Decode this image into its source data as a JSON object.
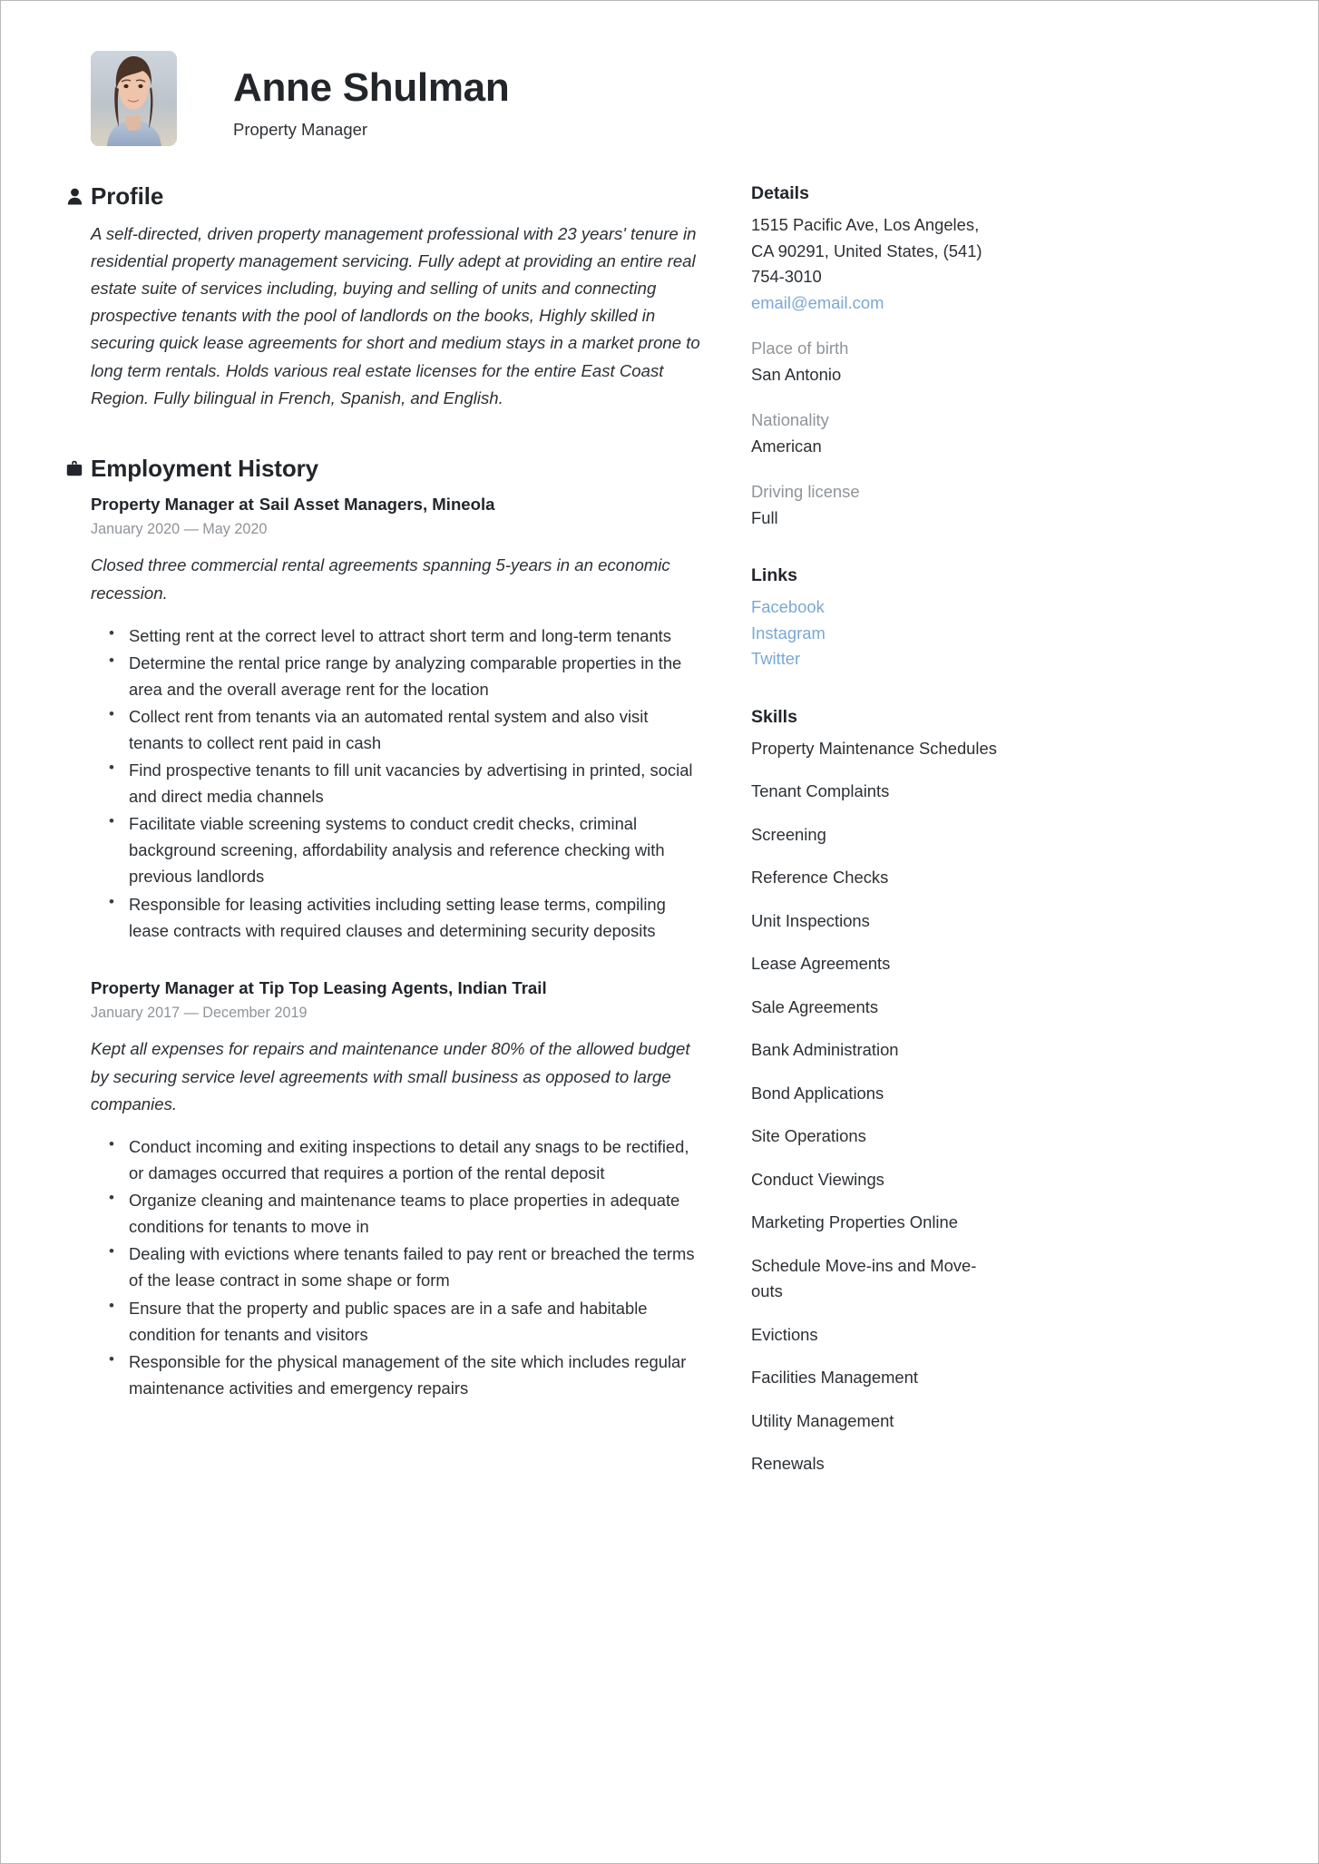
{
  "header": {
    "name": "Anne Shulman",
    "job_title": "Property Manager",
    "avatar_alt": "portrait-photo"
  },
  "profile": {
    "heading": "Profile",
    "icon": "person-icon",
    "text": "A self-directed, driven property management professional with 23 years' tenure in residential property management servicing. Fully adept at providing an entire real estate suite of services including, buying and selling of units and connecting prospective tenants with the pool of landlords on the books, Highly skilled in securing quick lease agreements for short and medium stays in a market prone to long term rentals. Holds various real estate licenses for the entire East Coast Region. Fully bilingual in French, Spanish, and English."
  },
  "employment": {
    "heading": "Employment History",
    "icon": "briefcase-icon",
    "jobs": [
      {
        "role": "Property Manager at",
        "company": "Sail Asset Managers, Mineola",
        "dates": "January 2020 — May 2020",
        "summary": "Closed three commercial rental agreements spanning 5-years in an economic recession.",
        "bullets": [
          "Setting rent at the correct level to attract short term and long-term tenants",
          "Determine the rental price range by analyzing comparable properties in the area and the overall average rent for the location",
          "Collect rent from tenants via an automated rental system and also visit tenants to collect rent paid in cash",
          "Find prospective tenants to fill unit vacancies by advertising in printed, social and direct media channels",
          "Facilitate viable screening systems to conduct credit checks, criminal background screening, affordability analysis and reference checking with previous landlords",
          "Responsible for leasing activities including setting lease terms, compiling lease contracts with required clauses and determining security deposits"
        ]
      },
      {
        "role": "Property Manager at",
        "company": "Tip Top Leasing Agents, Indian Trail",
        "dates": "January 2017 — December 2019",
        "summary": "Kept all expenses for repairs and maintenance under 80% of the allowed budget by securing service level agreements with small business as opposed to large companies.",
        "bullets": [
          "Conduct incoming and exiting inspections to detail any snags to be rectified, or damages occurred that requires a portion of the rental deposit",
          "Organize cleaning and maintenance teams to place properties in adequate conditions for tenants to move in",
          "Dealing with evictions where tenants failed to pay rent or breached the terms of the lease contract in some shape or form",
          "Ensure that the property and public spaces are in a safe and habitable condition for tenants and visitors",
          "Responsible for the physical management of the site which includes regular maintenance activities and emergency repairs"
        ]
      }
    ]
  },
  "details": {
    "heading": "Details",
    "address_line1": "1515 Pacific Ave, Los Angeles,",
    "address_line2": "CA 90291, United States, (541)",
    "address_line3": "754-3010",
    "email": "email@email.com",
    "fields": [
      {
        "label": "Place of birth",
        "value": "San Antonio"
      },
      {
        "label": "Nationality",
        "value": "American"
      },
      {
        "label": "Driving license",
        "value": "Full"
      }
    ]
  },
  "links": {
    "heading": "Links",
    "items": [
      "Facebook",
      "Instagram",
      "Twitter"
    ]
  },
  "skills": {
    "heading": "Skills",
    "items": [
      "Property Maintenance Schedules",
      "Tenant Complaints",
      "Screening",
      "Reference Checks",
      "Unit Inspections",
      "Lease Agreements",
      "Sale Agreements",
      "Bank Administration",
      "Bond Applications",
      "Site Operations",
      "Conduct Viewings",
      "Marketing Properties Online",
      "Schedule Move-ins and Move-outs",
      "Evictions",
      "Facilities Management",
      "Utility Management",
      "Renewals"
    ]
  },
  "colors": {
    "link": "#7aa8d6",
    "text": "#2c3034",
    "muted": "#8f9499",
    "heading": "#22262b"
  }
}
